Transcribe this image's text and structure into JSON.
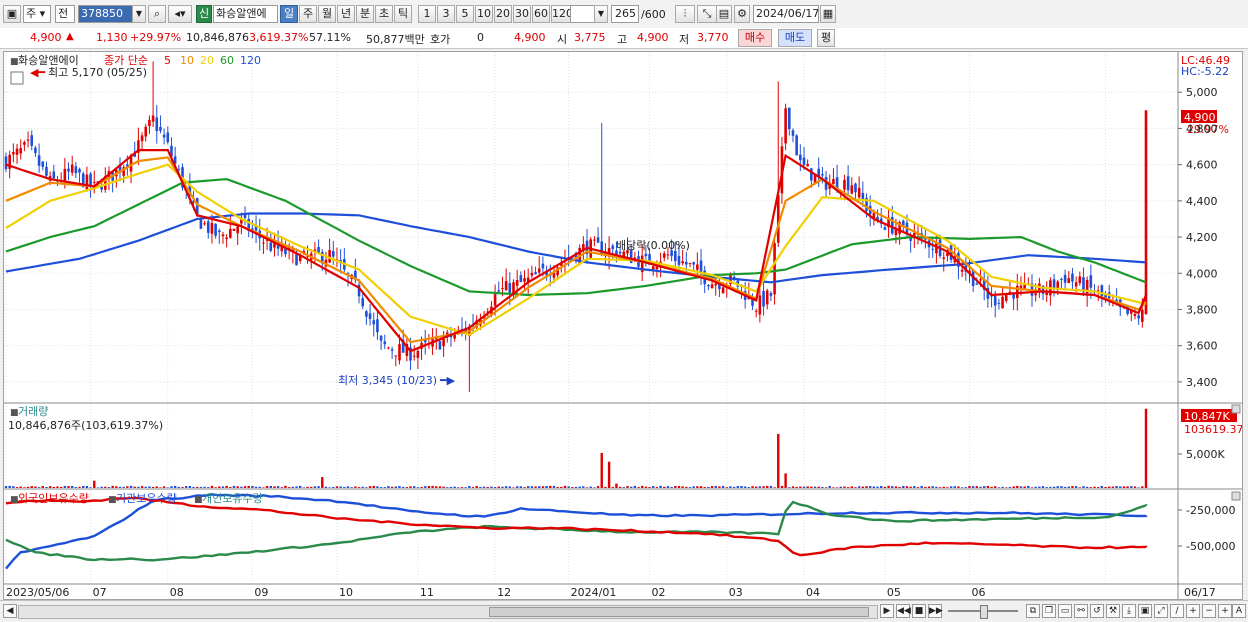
{
  "toolbar": {
    "market_type": "주",
    "view_mode": "전",
    "stock_code": "378850",
    "credit_label": "신",
    "stock_name": "화승알앤에",
    "periods": [
      "일",
      "주",
      "월",
      "년",
      "분",
      "초",
      "틱"
    ],
    "active_period": "일",
    "intervals": [
      "1",
      "3",
      "5",
      "10",
      "20",
      "30",
      "60",
      "120"
    ],
    "count_display": "265",
    "count_total": "/600",
    "date": "2024/06/17"
  },
  "price_bar": {
    "price": "4,900",
    "change": "1,130",
    "change_rate": "+29.97%",
    "volume": "10,846,876",
    "volume_ratio": "3,619.37%",
    "turnover": "57.11%",
    "trade_value": "50,877백만",
    "quote_label": "호가",
    "quote_value": "0",
    "quote_price": "4,900",
    "open_label": "시",
    "open": "3,775",
    "high_label": "고",
    "high": "4,900",
    "low_label": "저",
    "low": "3,770",
    "buy_label": "매수",
    "sell_label": "매도",
    "eval_label": "평"
  },
  "price_panel": {
    "name_tag": "화승알앤에이",
    "ma_title": "종가 단순",
    "ma_periods": [
      "5",
      "10",
      "20",
      "60",
      "120"
    ],
    "ma_colors": [
      "#e00000",
      "#f08c00",
      "#f0d000",
      "#1a9a2a",
      "#1e4fd8"
    ],
    "high_note": "최고 5,170 (05/25)",
    "low_note": "최저 3,345 (10/23)",
    "dividend_note": "배당락(0.00%)",
    "lc": "LC:46.49",
    "hc": "HC:-5.22",
    "last_price_tag": "4,900",
    "last_change_tag": "29.97%",
    "y_ticks": [
      "5,000",
      "4,800",
      "4,600",
      "4,400",
      "4,200",
      "4,000",
      "3,800",
      "3,600",
      "3,400"
    ]
  },
  "volume_panel": {
    "title": "거래량",
    "value_text": "10,846,876주(103,619.37%)",
    "tag_value": "10,847K",
    "tag_ratio": "103619.37",
    "y_tick": "5,000K"
  },
  "holdings_panel": {
    "legend": [
      "외국인보유수량",
      "기관보유수량",
      "개인보유수량"
    ],
    "colors": [
      "#e00000",
      "#1e4fd8",
      "#2a8a4a"
    ],
    "y_ticks": [
      "-250,000",
      "-500,000"
    ]
  },
  "x_axis": [
    "2023/05/06",
    "07",
    "08",
    "09",
    "10",
    "11",
    "12",
    "2024/01",
    "02",
    "03",
    "04",
    "05",
    "06",
    "06/17"
  ],
  "chart_data": {
    "type": "candlestick",
    "ylim": [
      3300,
      5200
    ],
    "anchors_close": [
      [
        0,
        4620
      ],
      [
        6,
        4700
      ],
      [
        12,
        4500
      ],
      [
        18,
        4560
      ],
      [
        24,
        4470
      ],
      [
        30,
        4560
      ],
      [
        36,
        4700
      ],
      [
        40,
        4850
      ],
      [
        44,
        4700
      ],
      [
        52,
        4300
      ],
      [
        58,
        4200
      ],
      [
        64,
        4280
      ],
      [
        72,
        4150
      ],
      [
        80,
        4080
      ],
      [
        88,
        4100
      ],
      [
        96,
        3900
      ],
      [
        102,
        3600
      ],
      [
        110,
        3560
      ],
      [
        118,
        3620
      ],
      [
        126,
        3700
      ],
      [
        134,
        3900
      ],
      [
        142,
        3960
      ],
      [
        150,
        4050
      ],
      [
        158,
        4150
      ],
      [
        166,
        4120
      ],
      [
        174,
        4060
      ],
      [
        180,
        4100
      ],
      [
        186,
        4040
      ],
      [
        192,
        3950
      ],
      [
        198,
        3960
      ],
      [
        204,
        3820
      ],
      [
        208,
        3880
      ],
      [
        212,
        4920
      ],
      [
        216,
        4600
      ],
      [
        222,
        4500
      ],
      [
        230,
        4500
      ],
      [
        236,
        4300
      ],
      [
        242,
        4250
      ],
      [
        248,
        4200
      ],
      [
        256,
        4120
      ],
      [
        262,
        4000
      ],
      [
        268,
        3850
      ],
      [
        274,
        3900
      ],
      [
        282,
        3900
      ],
      [
        288,
        3980
      ],
      [
        296,
        3900
      ],
      [
        302,
        3800
      ],
      [
        306,
        3760
      ],
      [
        309,
        3770
      ],
      [
        310,
        4900
      ]
    ],
    "ma5": [
      [
        0,
        4600
      ],
      [
        12,
        4520
      ],
      [
        24,
        4480
      ],
      [
        36,
        4680
      ],
      [
        44,
        4680
      ],
      [
        52,
        4320
      ],
      [
        64,
        4260
      ],
      [
        80,
        4100
      ],
      [
        96,
        3920
      ],
      [
        110,
        3570
      ],
      [
        126,
        3700
      ],
      [
        142,
        3950
      ],
      [
        158,
        4140
      ],
      [
        174,
        4060
      ],
      [
        192,
        3960
      ],
      [
        204,
        3850
      ],
      [
        212,
        4650
      ],
      [
        222,
        4520
      ],
      [
        236,
        4300
      ],
      [
        256,
        4120
      ],
      [
        268,
        3880
      ],
      [
        282,
        3900
      ],
      [
        296,
        3880
      ],
      [
        308,
        3780
      ],
      [
        310,
        3880
      ]
    ],
    "ma10": [
      [
        0,
        4400
      ],
      [
        12,
        4500
      ],
      [
        24,
        4480
      ],
      [
        36,
        4620
      ],
      [
        44,
        4640
      ],
      [
        52,
        4380
      ],
      [
        64,
        4260
      ],
      [
        80,
        4120
      ],
      [
        96,
        3960
      ],
      [
        110,
        3620
      ],
      [
        126,
        3680
      ],
      [
        142,
        3920
      ],
      [
        158,
        4120
      ],
      [
        174,
        4060
      ],
      [
        192,
        3970
      ],
      [
        204,
        3860
      ],
      [
        212,
        4400
      ],
      [
        222,
        4520
      ],
      [
        236,
        4340
      ],
      [
        256,
        4140
      ],
      [
        268,
        3930
      ],
      [
        282,
        3900
      ],
      [
        296,
        3880
      ],
      [
        308,
        3800
      ],
      [
        310,
        3840
      ]
    ],
    "ma20": [
      [
        0,
        4250
      ],
      [
        12,
        4400
      ],
      [
        24,
        4470
      ],
      [
        36,
        4550
      ],
      [
        44,
        4600
      ],
      [
        52,
        4450
      ],
      [
        64,
        4300
      ],
      [
        80,
        4150
      ],
      [
        96,
        4020
      ],
      [
        110,
        3760
      ],
      [
        126,
        3660
      ],
      [
        142,
        3860
      ],
      [
        158,
        4080
      ],
      [
        174,
        4070
      ],
      [
        192,
        3990
      ],
      [
        204,
        3900
      ],
      [
        212,
        4150
      ],
      [
        222,
        4420
      ],
      [
        236,
        4400
      ],
      [
        256,
        4180
      ],
      [
        268,
        3980
      ],
      [
        282,
        3920
      ],
      [
        296,
        3900
      ],
      [
        308,
        3840
      ],
      [
        310,
        3830
      ]
    ],
    "ma60": [
      [
        0,
        4120
      ],
      [
        12,
        4200
      ],
      [
        24,
        4260
      ],
      [
        36,
        4380
      ],
      [
        48,
        4500
      ],
      [
        60,
        4520
      ],
      [
        76,
        4400
      ],
      [
        96,
        4180
      ],
      [
        110,
        4040
      ],
      [
        126,
        3900
      ],
      [
        142,
        3880
      ],
      [
        158,
        3890
      ],
      [
        174,
        3930
      ],
      [
        192,
        3990
      ],
      [
        204,
        4000
      ],
      [
        212,
        4020
      ],
      [
        230,
        4160
      ],
      [
        246,
        4200
      ],
      [
        262,
        4190
      ],
      [
        276,
        4200
      ],
      [
        286,
        4120
      ],
      [
        296,
        4060
      ],
      [
        310,
        3950
      ]
    ],
    "ma120": [
      [
        0,
        4010
      ],
      [
        20,
        4080
      ],
      [
        36,
        4180
      ],
      [
        52,
        4300
      ],
      [
        66,
        4330
      ],
      [
        80,
        4330
      ],
      [
        96,
        4320
      ],
      [
        110,
        4260
      ],
      [
        126,
        4200
      ],
      [
        142,
        4120
      ],
      [
        158,
        4060
      ],
      [
        174,
        4020
      ],
      [
        192,
        3980
      ],
      [
        208,
        3950
      ],
      [
        222,
        3990
      ],
      [
        240,
        4020
      ],
      [
        260,
        4050
      ],
      [
        278,
        4100
      ],
      [
        296,
        4080
      ],
      [
        310,
        4060
      ]
    ],
    "volume_spikes": [
      [
        24,
        1000000
      ],
      [
        86,
        1500000
      ],
      [
        162,
        4800000
      ],
      [
        164,
        3600000
      ],
      [
        166,
        600000
      ],
      [
        210,
        7400000
      ],
      [
        212,
        2000000
      ],
      [
        310,
        10847000
      ]
    ],
    "foreign": [
      [
        0,
        -180000
      ],
      [
        10,
        -160000
      ],
      [
        20,
        -170000
      ],
      [
        34,
        -140000
      ],
      [
        40,
        -160000
      ],
      [
        52,
        -200000
      ],
      [
        70,
        -230000
      ],
      [
        90,
        -290000
      ],
      [
        110,
        -330000
      ],
      [
        130,
        -360000
      ],
      [
        150,
        -360000
      ],
      [
        170,
        -380000
      ],
      [
        190,
        -400000
      ],
      [
        210,
        -450000
      ],
      [
        215,
        -560000
      ],
      [
        230,
        -500000
      ],
      [
        250,
        -470000
      ],
      [
        270,
        -480000
      ],
      [
        290,
        -500000
      ],
      [
        310,
        -500000
      ]
    ],
    "institution": [
      [
        0,
        -650000
      ],
      [
        4,
        -540000
      ],
      [
        14,
        -480000
      ],
      [
        24,
        -420000
      ],
      [
        30,
        -330000
      ],
      [
        40,
        -160000
      ],
      [
        56,
        -120000
      ],
      [
        72,
        -130000
      ],
      [
        92,
        -170000
      ],
      [
        110,
        -240000
      ],
      [
        130,
        -280000
      ],
      [
        140,
        -220000
      ],
      [
        170,
        -270000
      ],
      [
        190,
        -270000
      ],
      [
        210,
        -260000
      ],
      [
        230,
        -250000
      ],
      [
        250,
        -250000
      ],
      [
        270,
        -250000
      ],
      [
        290,
        -260000
      ],
      [
        310,
        -270000
      ]
    ],
    "individual": [
      [
        0,
        -440000
      ],
      [
        8,
        -540000
      ],
      [
        16,
        -560000
      ],
      [
        24,
        -590000
      ],
      [
        32,
        -580000
      ],
      [
        40,
        -590000
      ],
      [
        56,
        -560000
      ],
      [
        72,
        -520000
      ],
      [
        90,
        -470000
      ],
      [
        110,
        -390000
      ],
      [
        130,
        -350000
      ],
      [
        150,
        -370000
      ],
      [
        170,
        -390000
      ],
      [
        190,
        -390000
      ],
      [
        210,
        -400000
      ],
      [
        213,
        -160000
      ],
      [
        224,
        -260000
      ],
      [
        240,
        -310000
      ],
      [
        260,
        -300000
      ],
      [
        280,
        -290000
      ],
      [
        300,
        -280000
      ],
      [
        310,
        -200000
      ]
    ]
  }
}
